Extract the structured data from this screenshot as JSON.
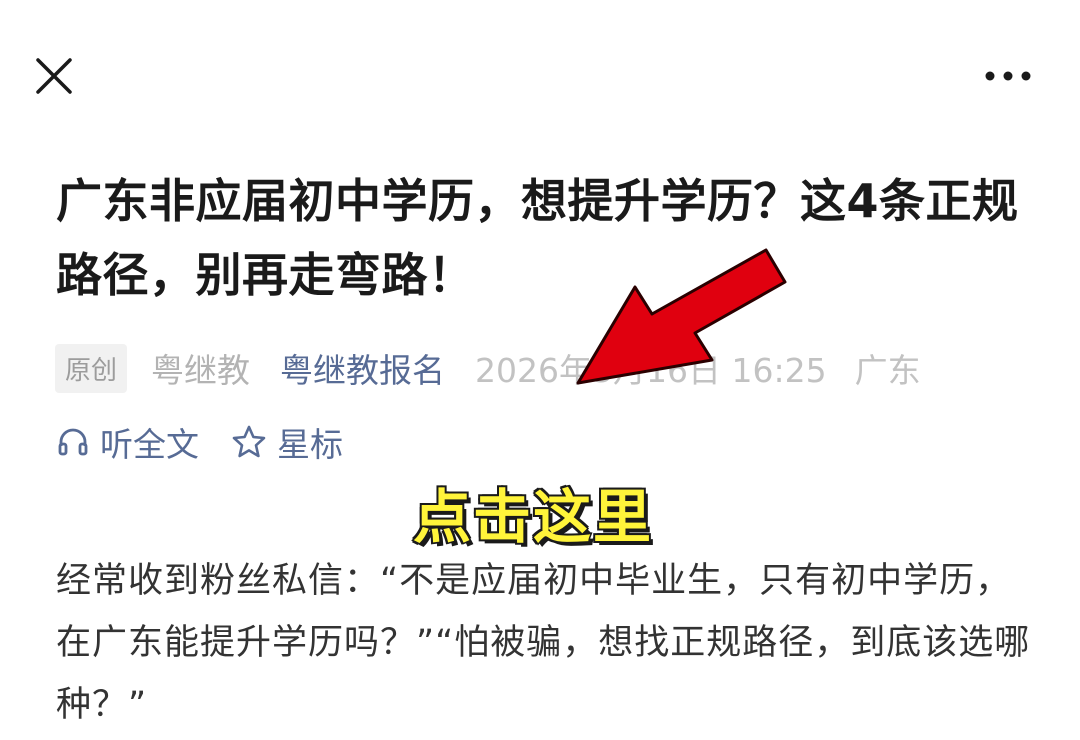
{
  "article": {
    "title": "广东非应届初中学历，想提升学历？这4条正规路径，别再走弯路！",
    "meta": {
      "badge": "原创",
      "author": "粤继教",
      "account": "粤继教报名",
      "datetime": "2026年3月16日 16:25",
      "location": "广东"
    },
    "actions": {
      "listen_label": "听全文",
      "star_label": "星标"
    },
    "overlay_text": "点击这里",
    "body": "经常收到粉丝私信：“不是应届初中毕业生，只有初中学历，在广东能提升学历吗？”“怕被骗，想找正规路径，到底该选哪种？”"
  },
  "colors": {
    "link": "#576b95",
    "meta_gray": "#c2c2c2",
    "arrow_red": "#e0000f",
    "overlay_yellow": "#fff43a"
  },
  "icons": {
    "close": "close-icon",
    "more": "more-dots-icon",
    "listen": "headphones-icon",
    "star": "star-icon",
    "arrow": "red-arrow"
  }
}
